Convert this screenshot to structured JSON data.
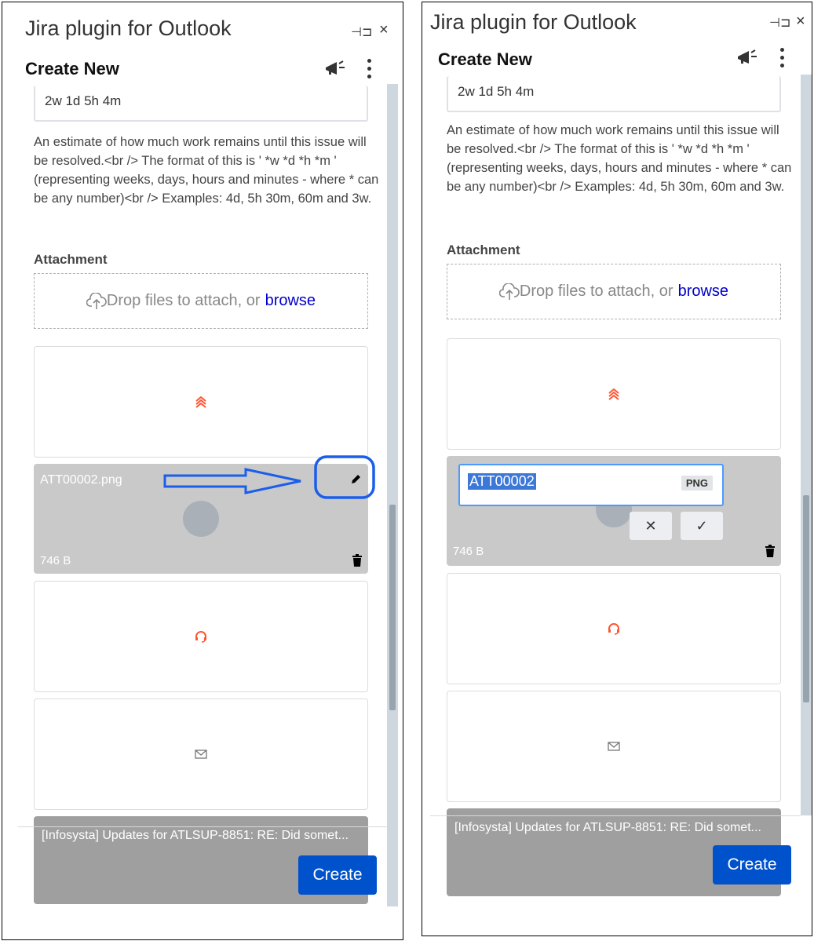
{
  "app": {
    "title": "Jira plugin for Outlook",
    "pin_glyph": "⊣⊐",
    "close_glyph": "×",
    "header": "Create New"
  },
  "form": {
    "remaining_estimate_value": "2w 1d 5h 4m",
    "remaining_estimate_help": "An estimate of how much work remains until this issue will be resolved.<br /> The format of this is ' *w *d *h *m ' (representing weeks, days, hours and minutes - where * can be any number)<br /> Examples: 4d, 5h 30m, 60m and 3w.",
    "attachment_label": "Attachment",
    "drop_text": "Drop files to attach, or",
    "browse_link": "browse"
  },
  "attachment": {
    "file_name": "ATT00002.png",
    "file_size": "746 B",
    "rename_value": "ATT00002",
    "rename_extension": "PNG",
    "cancel_glyph": "✕",
    "confirm_glyph": "✓"
  },
  "email_card": {
    "subject": "[Infosysta] Updates for ATLSUP-8851: RE: Did somet..."
  },
  "footer": {
    "create_label": "Create"
  },
  "colors": {
    "accent_blue": "#0052cc",
    "priority_red": "#ff5630",
    "annotation_blue": "#1a5eea"
  },
  "icons": [
    "pin-icon",
    "close-icon",
    "megaphone-icon",
    "kebab-icon",
    "cloud-upload-icon",
    "highest-priority-icon",
    "edit-pencil-icon",
    "trash-icon",
    "headset-icon",
    "mail-icon"
  ]
}
